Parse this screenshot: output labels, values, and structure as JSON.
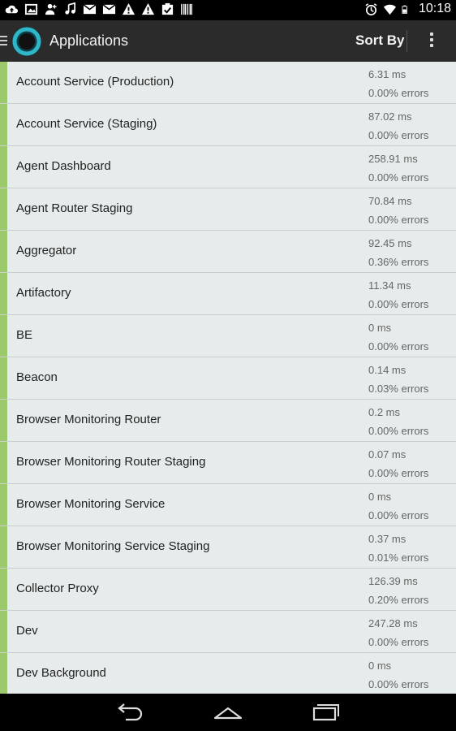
{
  "status_bar": {
    "time": "10:18",
    "left_icons": [
      "cloud-upload-icon",
      "image-icon",
      "add-person-icon",
      "music-note-icon",
      "mail-icon",
      "mail-icon",
      "warning-icon",
      "warning-icon",
      "checkbox-icon",
      "barcode-icon"
    ],
    "right_icons": [
      "alarm-icon",
      "wifi-icon",
      "battery-icon"
    ]
  },
  "action_bar": {
    "title": "Applications",
    "sort_label": "Sort By",
    "accent": "#2fb7c9"
  },
  "applications": [
    {
      "name": "Account Service (Production)",
      "response_time": "6.31 ms",
      "error_rate": "0.00% errors",
      "status": "#9bc96b"
    },
    {
      "name": "Account Service (Staging)",
      "response_time": "87.02 ms",
      "error_rate": "0.00% errors",
      "status": "#9bc96b"
    },
    {
      "name": "Agent Dashboard",
      "response_time": "258.91 ms",
      "error_rate": "0.00% errors",
      "status": "#9bc96b"
    },
    {
      "name": "Agent Router Staging",
      "response_time": "70.84 ms",
      "error_rate": "0.00% errors",
      "status": "#9bc96b"
    },
    {
      "name": "Aggregator",
      "response_time": "92.45 ms",
      "error_rate": "0.36% errors",
      "status": "#9bc96b"
    },
    {
      "name": "Artifactory",
      "response_time": "11.34 ms",
      "error_rate": "0.00% errors",
      "status": "#9bc96b"
    },
    {
      "name": "BE",
      "response_time": "0 ms",
      "error_rate": "0.00% errors",
      "status": "#9bc96b"
    },
    {
      "name": "Beacon",
      "response_time": "0.14 ms",
      "error_rate": "0.03% errors",
      "status": "#9bc96b"
    },
    {
      "name": "Browser Monitoring Router",
      "response_time": "0.2 ms",
      "error_rate": "0.00% errors",
      "status": "#9bc96b"
    },
    {
      "name": "Browser Monitoring Router Staging",
      "response_time": "0.07 ms",
      "error_rate": "0.00% errors",
      "status": "#9bc96b"
    },
    {
      "name": "Browser Monitoring Service",
      "response_time": "0 ms",
      "error_rate": "0.00% errors",
      "status": "#9bc96b"
    },
    {
      "name": "Browser Monitoring Service Staging",
      "response_time": "0.37 ms",
      "error_rate": "0.01% errors",
      "status": "#9bc96b"
    },
    {
      "name": "Collector Proxy",
      "response_time": "126.39 ms",
      "error_rate": "0.20% errors",
      "status": "#9bc96b"
    },
    {
      "name": "Dev",
      "response_time": "247.28 ms",
      "error_rate": "0.00% errors",
      "status": "#9bc96b"
    },
    {
      "name": "Dev Background",
      "response_time": "0 ms",
      "error_rate": "0.00% errors",
      "status": "#9bc96b"
    }
  ],
  "nav_bar": {
    "buttons": [
      "back-icon",
      "home-icon",
      "recent-apps-icon"
    ]
  }
}
